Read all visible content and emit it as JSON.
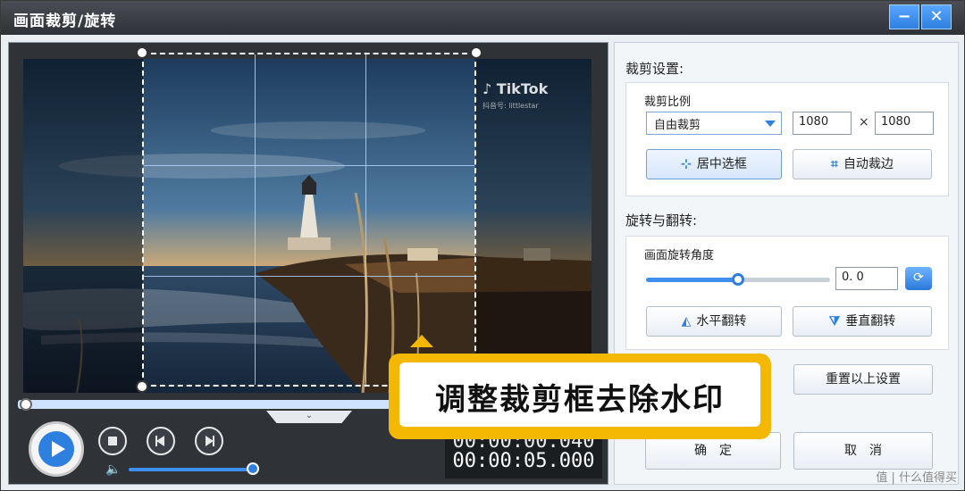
{
  "window": {
    "title": "画面裁剪/旋转",
    "minimize_label": "−",
    "close_label": "✕"
  },
  "video": {
    "watermark_logo": "♪ TikTok",
    "watermark_sub": "抖音号: littlestar",
    "collapse_label": "⌄",
    "time_current": "00:00:00.040",
    "time_total": "00:00:05.000",
    "volume_level": 0.9
  },
  "crop": {
    "section_title": "裁剪设置:",
    "ratio_label": "裁剪比例",
    "ratio_value": "自由裁剪",
    "width": "1080",
    "times": "×",
    "height": "1080",
    "center_button": "居中选框",
    "auto_button": "自动裁边"
  },
  "rotate": {
    "section_title": "旋转与翻转:",
    "angle_label": "画面旋转角度",
    "angle_value": "0. 0",
    "angle_fraction": 0.5,
    "flip_h_button": "水平翻转",
    "flip_v_button": "垂直翻转"
  },
  "actions": {
    "reset_button": "重置以上设置",
    "ok_button": "确　定",
    "cancel_button": "取　消"
  },
  "caption": {
    "text": "调整裁剪框去除水印"
  },
  "brand": "值 | 什么值得买",
  "colors": {
    "accent": "#2d7fe0",
    "caption_border": "#f5b800",
    "title_bar": "#2e3136"
  }
}
